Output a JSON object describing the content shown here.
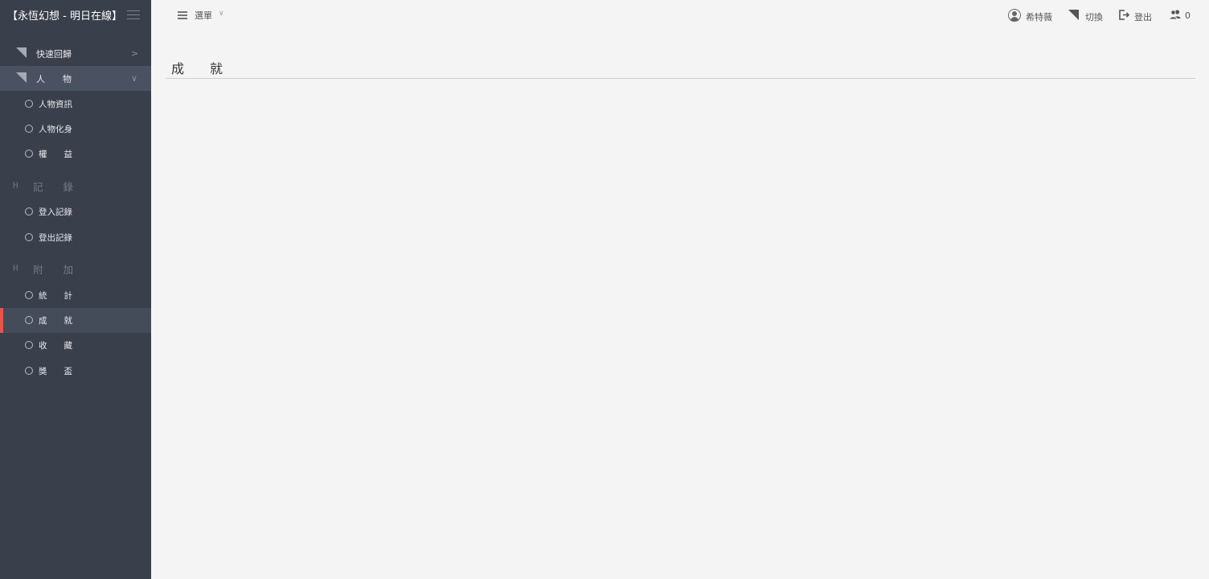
{
  "app": {
    "title": "【永恆幻想 - 明日在線】"
  },
  "sidebar": {
    "items": [
      {
        "label": "快速回歸",
        "chevron": ">"
      },
      {
        "label": "人　　物",
        "chevron": "∨"
      }
    ],
    "person_children": [
      "人物資訊",
      "人物化身",
      "權　　益"
    ],
    "sections": [
      {
        "label": "記　　錄",
        "children": [
          "登入記錄",
          "登出記錄"
        ]
      },
      {
        "label": "附　　加",
        "children": [
          "統　　計",
          "成　　就",
          "收　　藏",
          "獎　　盃"
        ]
      }
    ],
    "active_item": "成　　就"
  },
  "topbar": {
    "menu_label": "選單",
    "user_name": "希特薇",
    "switch_label": "切換",
    "logout_label": "登出",
    "online_count": "0"
  },
  "main": {
    "title": "成　　就"
  },
  "colors": {
    "sidebar_bg": "#393f4b",
    "active_bar": "#e9544a",
    "page_bg": "#f4f4f4"
  }
}
